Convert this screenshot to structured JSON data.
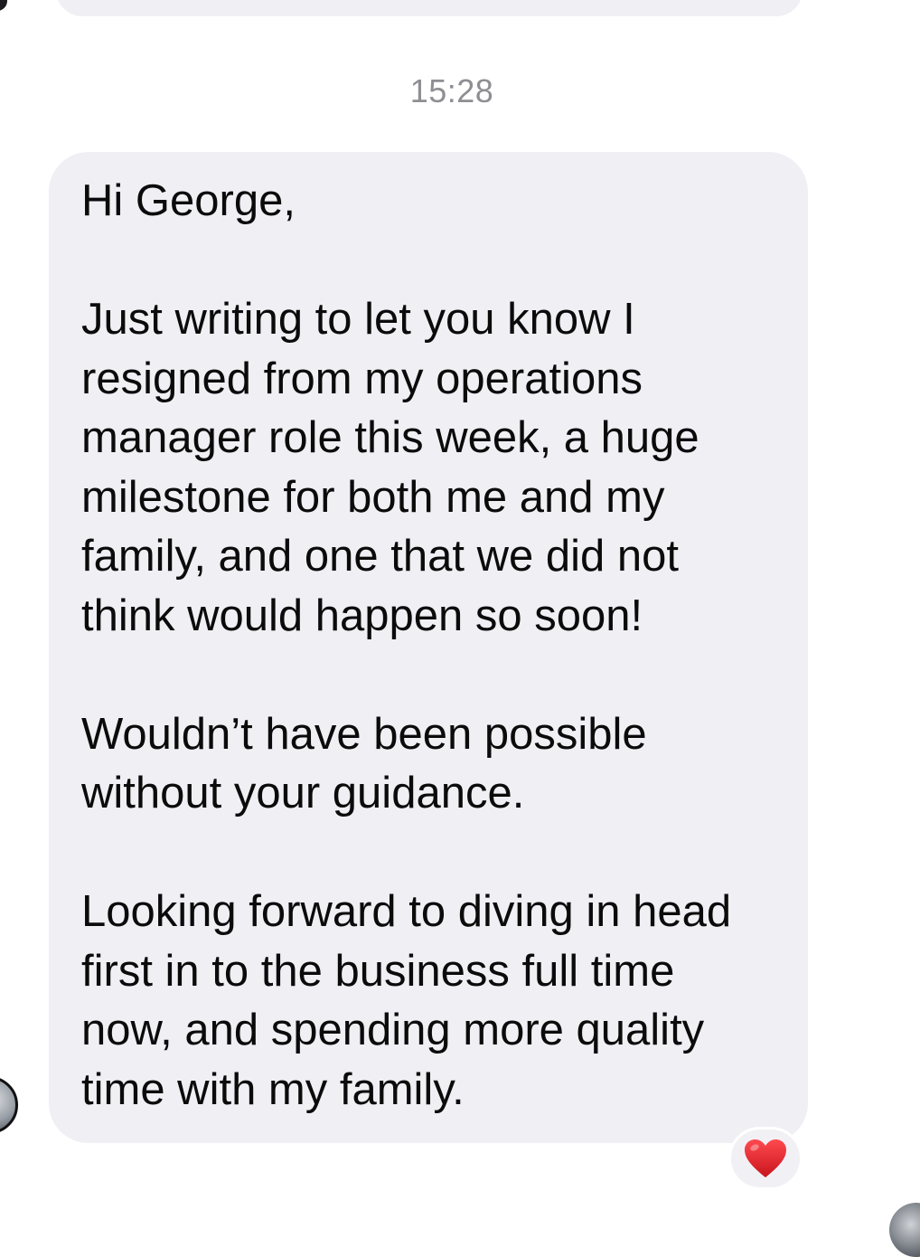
{
  "conversation": {
    "timestamp": "15:28",
    "message": {
      "text": "Hi George,\n\nJust writing to let you know I\nresigned from my operations\nmanager role this week, a huge\nmilestone for both me and my\nfamily, and one that we did not\nthink would happen so soon!\n\nWouldn’t have been possible\nwithout your guidance.\n\nLooking forward to diving in head\nfirst in to the business full time\nnow, and spending more quality\ntime with my family.",
      "reaction": {
        "icon": "heart-icon",
        "color": "#e0242b"
      }
    }
  }
}
